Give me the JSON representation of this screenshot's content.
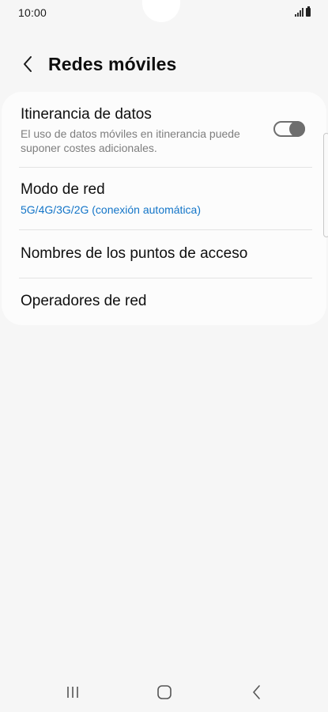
{
  "status_bar": {
    "time": "10:00",
    "icons": [
      "signal-icon",
      "battery-icon"
    ]
  },
  "header": {
    "title": "Redes móviles",
    "back_icon": "chevron-left-icon"
  },
  "settings": {
    "data_roaming": {
      "title": "Itinerancia de datos",
      "summary": "El uso de datos móviles en itinerancia puede suponer costes adicionales.",
      "enabled": false
    },
    "network_mode": {
      "title": "Modo de red",
      "value": "5G/4G/3G/2G (conexión automática)"
    },
    "access_point_names": {
      "title": "Nombres de los puntos de acceso"
    },
    "network_operators": {
      "title": "Operadores de red"
    }
  },
  "navigation_bar": {
    "buttons": [
      "recent-apps-icon",
      "home-icon",
      "back-icon"
    ]
  },
  "colors": {
    "background": "#f6f6f6",
    "card": "#fcfcfc",
    "accent": "#1375c8",
    "toggle_off": "#6e6e6e"
  }
}
